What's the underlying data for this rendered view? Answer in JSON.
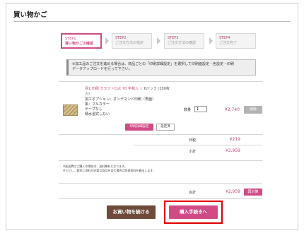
{
  "page": {
    "title": "買い物かご"
  },
  "steps": [
    {
      "num": "STEP1",
      "label": "買い物かごの確認",
      "active": true
    },
    {
      "num": "STEP2",
      "label": "ご注文方法の指定",
      "active": false
    },
    {
      "num": "STEP3",
      "label": "ご注文方法の確認",
      "active": false
    },
    {
      "num": "STEP4",
      "label": "ご注文完了",
      "active": false
    }
  ],
  "notice": {
    "line1": "※加工品のご注文を進める場合は、商品ごとの「印刷詳細設定」を選択して印刷面設定・色設定・印刷",
    "line2": "データアップロードを行って下さい。"
  },
  "item": {
    "name": "鳥1 印刷 クラフトCoC 70 宇和入",
    "meta": "☆ 6パック (100枚",
    "meta2": "入)",
    "details": [
      "加工オプション：オンデマンド印刷（表面）",
      "黒：フルカラー",
      "テープなし",
      "晴水湿式しない"
    ],
    "qty_label": "数量",
    "qty_value": "1",
    "price": "¥2,740",
    "delete_label": "削除",
    "print_settings_label": "印刷詳細設定",
    "settings_done_label": "設定済"
  },
  "summary": {
    "shipping_label": "外税",
    "shipping_value": "¥219",
    "subtotal_label": "小計",
    "subtotal_value": "¥2,959",
    "total_label": "合計",
    "total_value": "¥2,959"
  },
  "footnote": {
    "line1": "※配送費はご購入の場合は、送料無料となります。",
    "line2": "※ただし、個別に送料が必要な商品を含む場合は別途送料を算出します。"
  },
  "buttons": {
    "recalc": "再計算",
    "continue": "お買い物を続ける",
    "checkout": "購入手続きへ"
  },
  "colors": {
    "accent": "#d14b86",
    "continue_bg": "#6e4b3a",
    "highlight": "#e00000"
  }
}
